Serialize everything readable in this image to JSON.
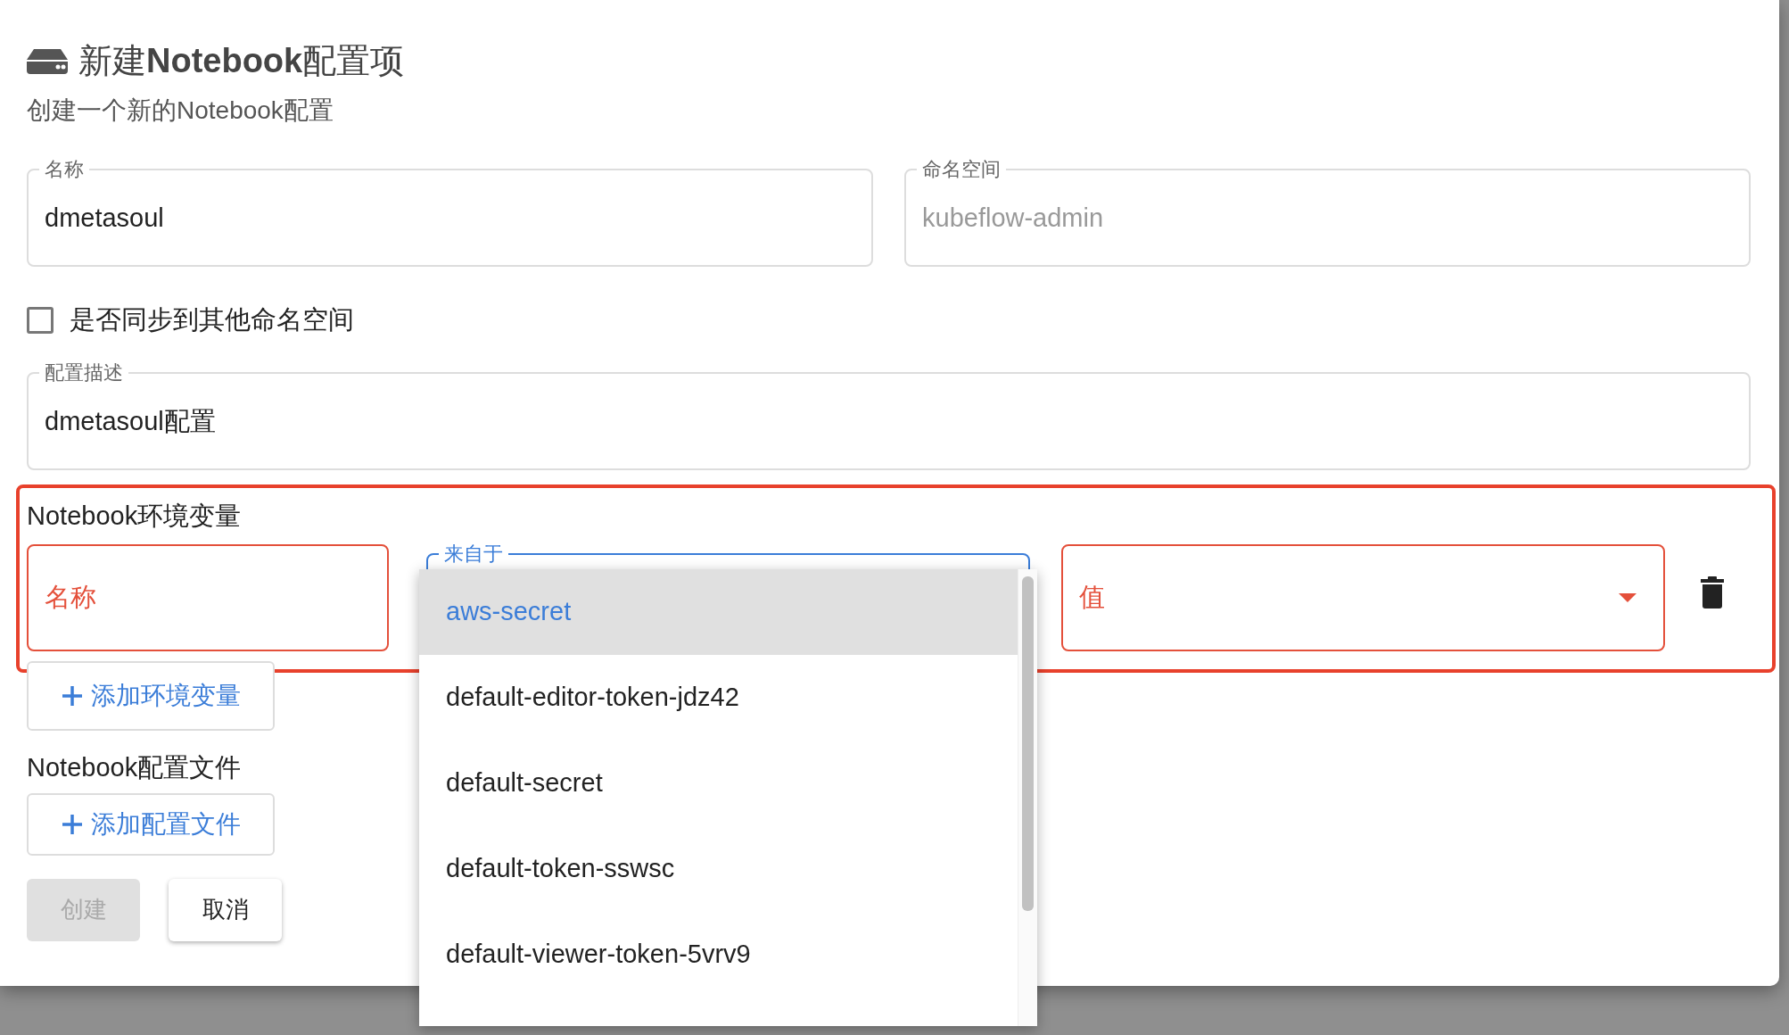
{
  "dialog": {
    "title": "新建**Notebook**配置项",
    "subtitle": "创建一个新的Notebook配置",
    "fields": [
      {
        "label": "名称",
        "value": "dmetasoul",
        "disabled": false
      },
      {
        "label": "命名空间",
        "value": "kubeflow-admin",
        "disabled": true
      }
    ],
    "sync_checkbox": {
      "label": "是否同步到其他命名空间",
      "checked": false
    },
    "description": {
      "label": "配置描述",
      "value": "dmetasoul配置"
    },
    "env_section": {
      "title": "Notebook环境变量",
      "highlighted": true,
      "name_field": {
        "placeholder": "名称",
        "invalid": true
      },
      "source_field": {
        "label": "来自于",
        "focused": true
      },
      "value_field": {
        "placeholder": "值",
        "invalid": true
      },
      "add_button": "添加环境变量"
    },
    "config_section": {
      "title": "Notebook配置文件",
      "add_button": "添加配置文件"
    },
    "buttons": [
      {
        "label": "创建",
        "disabled": true
      },
      {
        "label": "取消",
        "disabled": false
      }
    ]
  },
  "dropdown": {
    "options": [
      {
        "label": "aws-secret",
        "selected": true
      },
      {
        "label": "default-editor-token-jdz42",
        "selected": false
      },
      {
        "label": "default-secret",
        "selected": false
      },
      {
        "label": "default-token-sswsc",
        "selected": false
      },
      {
        "label": "default-viewer-token-5vrv9",
        "selected": false
      }
    ]
  }
}
